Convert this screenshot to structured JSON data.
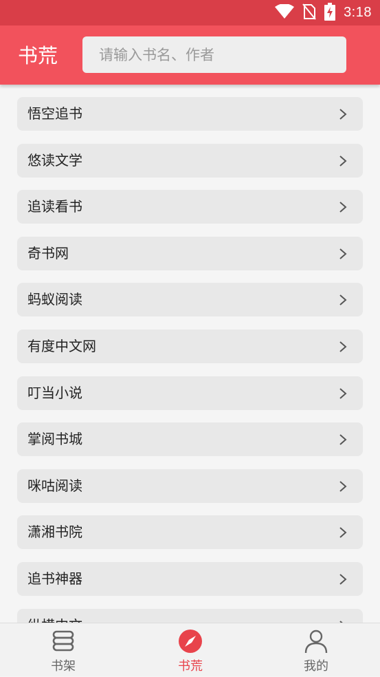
{
  "status_bar": {
    "time": "3:18"
  },
  "header": {
    "title": "书荒",
    "search_placeholder": "请输入书名、作者"
  },
  "sources": [
    {
      "label": "悟空追书"
    },
    {
      "label": "悠读文学"
    },
    {
      "label": "追读看书"
    },
    {
      "label": "奇书网"
    },
    {
      "label": "蚂蚁阅读"
    },
    {
      "label": "有度中文网"
    },
    {
      "label": "叮当小说"
    },
    {
      "label": "掌阅书城"
    },
    {
      "label": "咪咕阅读"
    },
    {
      "label": "潇湘书院"
    },
    {
      "label": "追书神器"
    },
    {
      "label": "纵横中文"
    }
  ],
  "tabs": [
    {
      "label": "书架",
      "icon": "bookshelf-icon",
      "active": false
    },
    {
      "label": "书荒",
      "icon": "compass-icon",
      "active": true
    },
    {
      "label": "我的",
      "icon": "person-icon",
      "active": false
    }
  ],
  "colors": {
    "accent": "#f2525c",
    "status_bar": "#d93e48",
    "active_tab": "#e8434b"
  }
}
